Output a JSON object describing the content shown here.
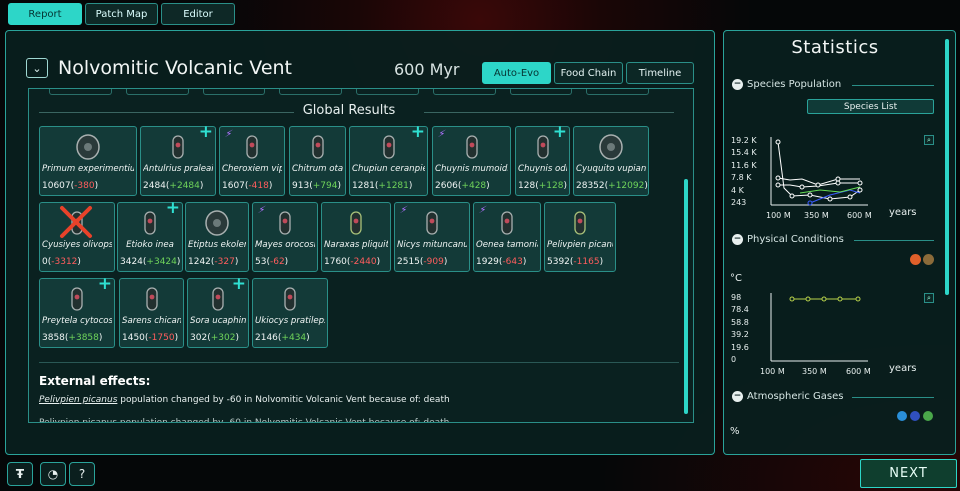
{
  "top_tabs": [
    {
      "label": "Report",
      "active": true
    },
    {
      "label": "Patch Map",
      "active": false
    },
    {
      "label": "Editor",
      "active": false
    }
  ],
  "report": {
    "patch_name": "Nolvomitic Volcanic Vent",
    "time": "600 Myr",
    "sub_tabs": [
      {
        "label": "Auto-Evo",
        "active": true
      },
      {
        "label": "Food Chain",
        "active": false
      },
      {
        "label": "Timeline",
        "active": false
      }
    ],
    "global_results_title": "Global Results",
    "species": [
      {
        "name": "Primum experimentium",
        "pop": "10607",
        "change": "-380",
        "badge": ""
      },
      {
        "name": "Antulrius praleais",
        "pop": "2484",
        "change": "+2484",
        "badge": "new"
      },
      {
        "name": "Cheroxiem viperen",
        "pop": "1607",
        "change": "-418",
        "badge": "bolt"
      },
      {
        "name": "Chitrum otax",
        "pop": "913",
        "change": "+794",
        "badge": ""
      },
      {
        "name": "Chupiun ceranpien",
        "pop": "1281",
        "change": "+1281",
        "badge": "new"
      },
      {
        "name": "Chuynis mumoidia",
        "pop": "2606",
        "change": "+428",
        "badge": "bolt"
      },
      {
        "name": "Chuynis odix",
        "pop": "128",
        "change": "+128",
        "badge": "new"
      },
      {
        "name": "Cyuquito vupian",
        "pop": "28352",
        "change": "+12092",
        "badge": ""
      },
      {
        "name": "Cyusiyes olivopsis",
        "pop": "0",
        "change": "-3312",
        "badge": "extinct"
      },
      {
        "name": "Etioko inea",
        "pop": "3424",
        "change": "+3424",
        "badge": "new"
      },
      {
        "name": "Etiptus ekolera",
        "pop": "1242",
        "change": "-327",
        "badge": ""
      },
      {
        "name": "Mayes orocosia",
        "pop": "53",
        "change": "-62",
        "badge": "bolt"
      },
      {
        "name": "Naraxas pliquito",
        "pop": "1760",
        "change": "-2440",
        "badge": ""
      },
      {
        "name": "Nicys mituncanus",
        "pop": "2515",
        "change": "-909",
        "badge": "bolt"
      },
      {
        "name": "Oenea tamonia",
        "pop": "1929",
        "change": "-643",
        "badge": "bolt"
      },
      {
        "name": "Pelivpien picanus",
        "pop": "5392",
        "change": "-1165",
        "badge": ""
      },
      {
        "name": "Preytela cytocosia",
        "pop": "3858",
        "change": "+3858",
        "badge": "new"
      },
      {
        "name": "Sarens chicanus",
        "pop": "1450",
        "change": "-1750",
        "badge": ""
      },
      {
        "name": "Sora ucaphin",
        "pop": "302",
        "change": "+302",
        "badge": "new"
      },
      {
        "name": "Ukiocys pratilepsis",
        "pop": "2146",
        "change": "+434",
        "badge": ""
      }
    ],
    "external_effects_title": "External effects:",
    "external_effects": [
      {
        "species": "Pelivpien picanus",
        "text": " population changed by -60 in Nolvomitic Volcanic Vent because of: death"
      }
    ]
  },
  "statistics": {
    "title": "Statistics",
    "species_population": {
      "heading": "Species Population",
      "button": "Species List",
      "y_ticks": [
        "19.2 K",
        "15.4 K",
        "11.6 K",
        "7.8 K",
        "4 K",
        "243"
      ],
      "x_ticks": [
        "100 M",
        "350 M",
        "600 M"
      ],
      "x_unit": "years"
    },
    "physical_conditions": {
      "heading": "Physical Conditions",
      "unit": "°C",
      "y_ticks": [
        "98",
        "78.4",
        "58.8",
        "39.2",
        "19.6",
        "0"
      ],
      "x_ticks": [
        "100 M",
        "350 M",
        "600 M"
      ],
      "x_unit": "years"
    },
    "atmospheric_gases": {
      "heading": "Atmospheric Gases",
      "unit": "%"
    }
  },
  "bottom": {
    "next_label": "NEXT",
    "help_label": "?"
  },
  "colors": {
    "accent": "#2dd6c8",
    "negative": "#ff5d5d",
    "positive": "#6fd35a",
    "panel": "#091f1e"
  }
}
